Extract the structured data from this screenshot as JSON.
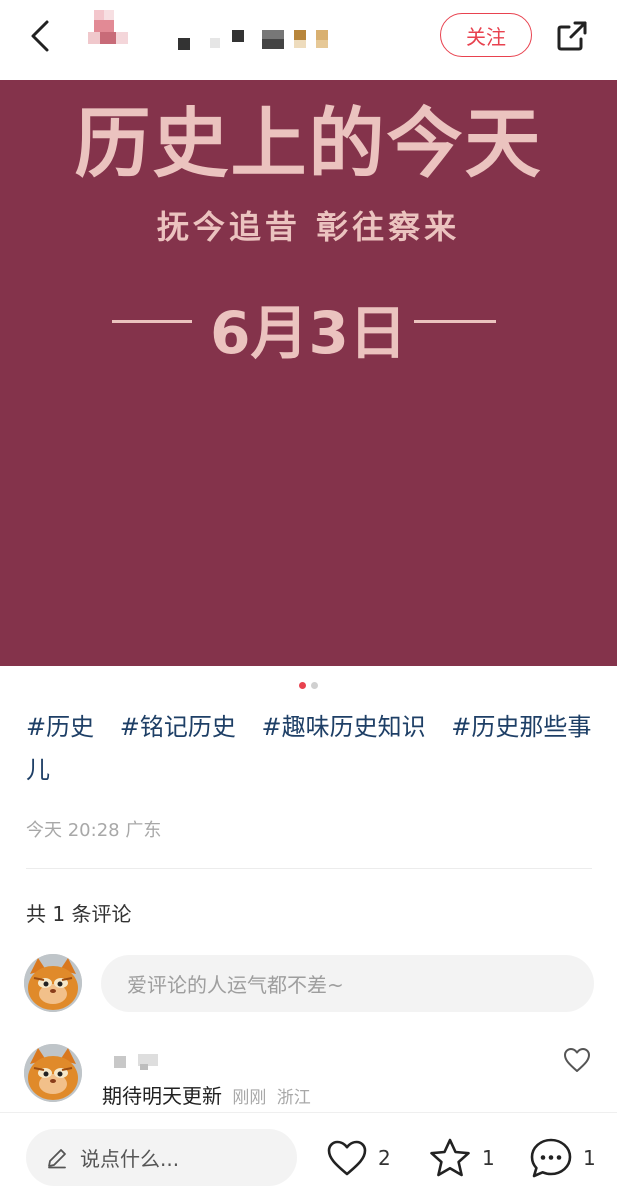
{
  "header": {
    "follow_label": "关注",
    "icons": {
      "back": "chevron-left-icon",
      "share": "share-external-icon"
    }
  },
  "hero": {
    "title": "历史上的今天",
    "subtitle": "抚今追昔  彰往察来",
    "date": "6月3日",
    "background_color": "#84334b",
    "text_color": "#ebc3bf"
  },
  "pager": {
    "count": 2,
    "active_index": 0
  },
  "post": {
    "tags": [
      "#历史",
      "#铭记历史",
      "#趣味历史知识",
      "#历史那些事儿"
    ],
    "meta": "今天 20:28 广东"
  },
  "comments": {
    "count_label": "共 1 条评论",
    "input_placeholder": "爱评论的人运气都不差~",
    "items": [
      {
        "text": "期待明天更新",
        "time": "刚刚",
        "location": "浙江"
      }
    ]
  },
  "bottom_bar": {
    "input_placeholder": "说点什么...",
    "likes": "2",
    "favorites": "1",
    "comments": "1"
  },
  "colors": {
    "accent": "#e8424f",
    "tag": "#1e3f66",
    "muted": "#a8a8a8"
  }
}
